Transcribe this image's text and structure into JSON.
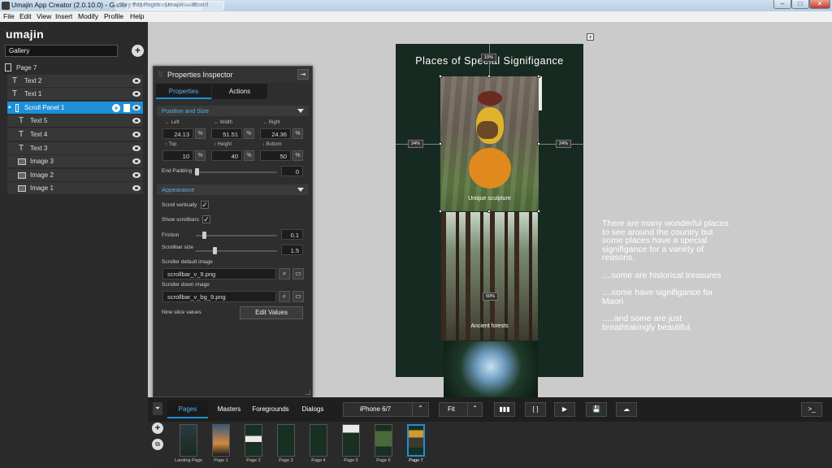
{
  "window": {
    "title": "Umajin App Creator (2.0.10.0) - Gallery *",
    "ghost_tab1": "Edit Pages - Umajin — iBoard",
    "ghost_tab2": "Edit Pages - Umajin — iBoard",
    "min": "–",
    "max": "□",
    "close": "✕"
  },
  "menu": [
    "File",
    "Edit",
    "View",
    "Insert",
    "Modify",
    "Profile",
    "Help"
  ],
  "sidebar": {
    "logo": "umajin",
    "gallery_value": "Gallery",
    "add_label": "+",
    "page_label": "Page 7",
    "items": [
      {
        "label": "Text 2",
        "icon": "text-icon"
      },
      {
        "label": "Text 1",
        "icon": "text-icon"
      },
      {
        "label": "Scroll Panel 1",
        "icon": "scroll-panel-icon"
      },
      {
        "label": "Text 5",
        "icon": "text-icon"
      },
      {
        "label": "Text 4",
        "icon": "text-icon"
      },
      {
        "label": "Text 3",
        "icon": "text-icon"
      },
      {
        "label": "Image 3",
        "icon": "image-icon"
      },
      {
        "label": "Image 2",
        "icon": "image-icon"
      },
      {
        "label": "Image 1",
        "icon": "image-icon"
      }
    ]
  },
  "inspector": {
    "title": "Properties Inspector",
    "tab_properties": "Properties",
    "tab_actions": "Actions",
    "section_position": "Position and Size",
    "left_label": "Left",
    "left_value": "24.13",
    "width_label": "Width",
    "width_value": "51.51",
    "right_label": "Right",
    "right_value": "24.36",
    "top_label": "Top",
    "top_value": "10",
    "height_label": "Height",
    "height_value": "40",
    "bottom_label": "Bottom",
    "bottom_value": "50",
    "unit": "%",
    "end_padding_label": "End Padding",
    "end_padding_value": "0",
    "section_appearance": "Appearance",
    "scroll_vertically_label": "Scroll vertically",
    "show_scrollbars_label": "Show scrollbars",
    "check": "✓",
    "friction_label": "Friction",
    "friction_value": "0.1",
    "scrollbar_size_label": "Scrollbar size",
    "scrollbar_size_value": "1.5",
    "scroller_default_label": "Scroller default image",
    "scroller_default_value": "scrollbar_v_9.png",
    "scroller_down_label": "Scroller down image",
    "scroller_down_value": "scrollbar_v_bg_9.png",
    "nine_slice_label": "Nine slice values",
    "edit_values_button": "Edit Values"
  },
  "canvas": {
    "title": "Places of Special Signifigance",
    "caption1": "Unique sculpture",
    "caption2": "Ancient forests",
    "pct_top": "10%",
    "pct_left": "24%",
    "pct_right": "24%",
    "pct_mid": "50%",
    "side_text": [
      "There are many wonderful places to see around the country but some places have a special signifigance for a variety of reasons.",
      "....some are historical treasures",
      "....some have signifigance for Maori",
      ".....and some are just breathtakingly beautiful."
    ]
  },
  "bottom": {
    "tabs": [
      "Pages",
      "Masters",
      "Foregrounds",
      "Dialogs"
    ],
    "device": "iPhone 6/7",
    "zoom": "Fit",
    "console": ">_",
    "thumbnails": [
      "Landing Page",
      "Page 1",
      "Page 2",
      "Page 3",
      "Page 4",
      "Page 5",
      "Page 6",
      "Page 7"
    ]
  },
  "colors": {
    "accent": "#1e8fd8",
    "phone_bg": "#172a21"
  }
}
